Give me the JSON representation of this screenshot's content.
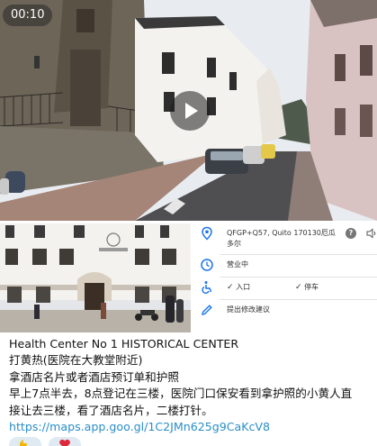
{
  "video": {
    "duration": "00:10",
    "play_icon": "play-icon"
  },
  "photo": {
    "sign_icon": "building-sign-icon"
  },
  "maps_panel": {
    "address_line1": "QFGP+Q57, Quito 170130厄瓜",
    "address_line2": "多尔",
    "hours": "营业中",
    "entrance": "入口",
    "parking": "停车",
    "suggest_edit": "提出修改建议",
    "icons": [
      "location-pin-icon",
      "clock-icon",
      "wheelchair-icon",
      "pencil-icon",
      "help-icon",
      "speaker-icon"
    ],
    "accent_color": "#1a73e8"
  },
  "message": {
    "title": "Health Center No 1 HISTORICAL CENTER",
    "line2": "打黄热(医院在大教堂附近)",
    "line3": "拿酒店名片或者酒店预订单和护照",
    "line4": "早上7点半去，8点登记在三楼，医院门口保安看到拿护照的小黄人直",
    "line5": "接让去三楼，看了酒店名片，二楼打针。",
    "link": "https://maps.app.goo.gl/1C2JMn625g9CaKcV8",
    "link_color": "#2a8ec7"
  },
  "reactions": [
    "thumbs-up",
    "heart"
  ]
}
